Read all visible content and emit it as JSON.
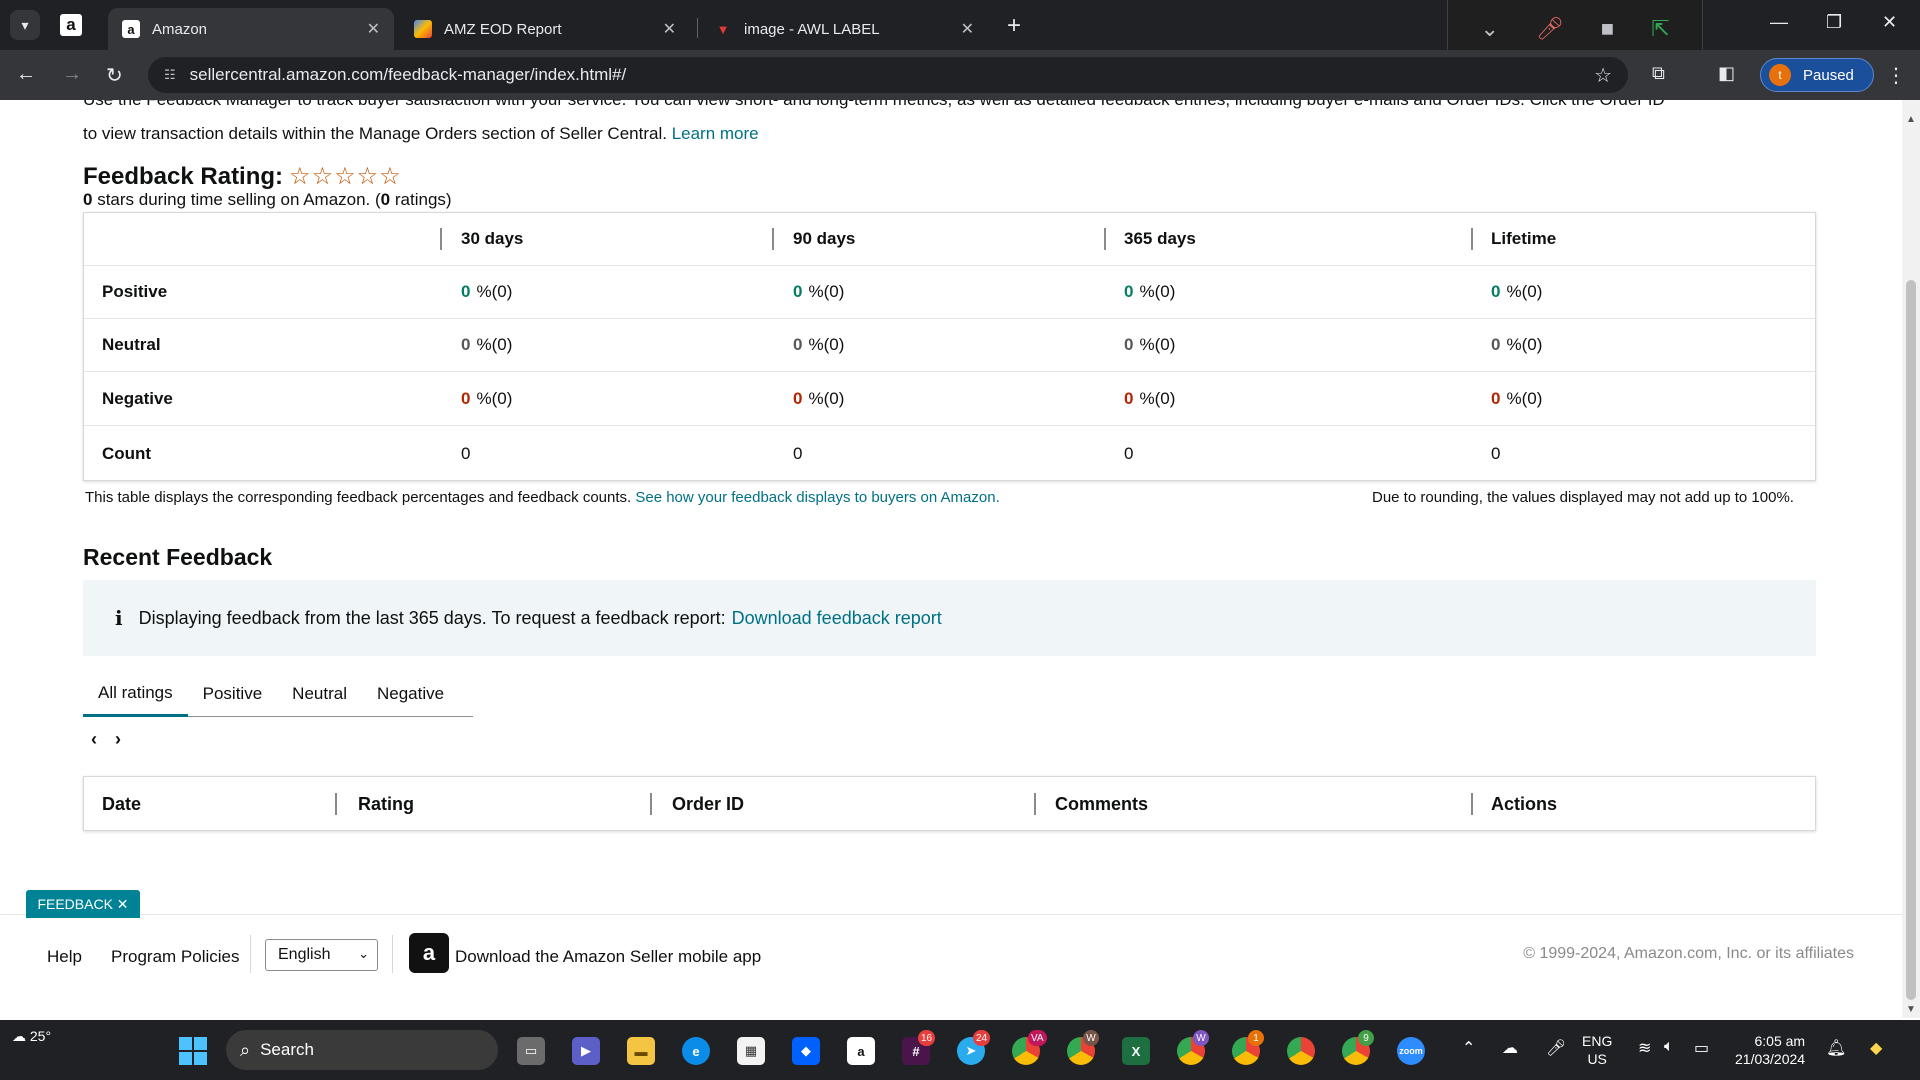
{
  "browser": {
    "tabs": [
      {
        "title": "Amazon",
        "active": true
      },
      {
        "title": "AMZ EOD Report",
        "active": false
      },
      {
        "title": "image - AWL LABEL",
        "active": false
      }
    ],
    "url": "sellercentral.amazon.com/feedback-manager/index.html#/",
    "profile": {
      "initial": "t",
      "label": "Paused"
    }
  },
  "intro": {
    "cut_line": "Use the Feedback Manager to track buyer satisfaction with your service. You can view short- and long-term metrics, as well as detailed feedback entries, including buyer e-mails and Order IDs. Click the Order ID",
    "text": "to view transaction details within the Manage Orders section of Seller Central.",
    "learn_more": "Learn more"
  },
  "rating": {
    "heading": "Feedback Rating:",
    "stars": "☆☆☆☆☆",
    "stars_count": "0",
    "during_text": "stars during time selling on Amazon. (",
    "ratings_count": "0",
    "ratings_suffix": "ratings)"
  },
  "feedback_table": {
    "columns": [
      "30 days",
      "90 days",
      "365 days",
      "Lifetime"
    ],
    "rows": [
      {
        "label": "Positive",
        "cells": [
          [
            "0",
            "%(0)"
          ],
          [
            "0",
            "%(0)"
          ],
          [
            "0",
            "%(0)"
          ],
          [
            "0",
            "%(0)"
          ]
        ]
      },
      {
        "label": "Neutral",
        "cells": [
          [
            "0",
            "%(0)"
          ],
          [
            "0",
            "%(0)"
          ],
          [
            "0",
            "%(0)"
          ],
          [
            "0",
            "%(0)"
          ]
        ]
      },
      {
        "label": "Negative",
        "cells": [
          [
            "0",
            "%(0)"
          ],
          [
            "0",
            "%(0)"
          ],
          [
            "0",
            "%(0)"
          ],
          [
            "0",
            "%(0)"
          ]
        ]
      },
      {
        "label": "Count",
        "cells": [
          "0",
          "0",
          "0",
          "0"
        ]
      }
    ]
  },
  "notes": {
    "left": "This table displays the corresponding feedback percentages and feedback counts.",
    "left_link": "See how your feedback displays to buyers on Amazon.",
    "right": "Due to rounding, the values displayed may not add up to 100%."
  },
  "recent": {
    "title": "Recent Feedback",
    "info_text": "Displaying feedback from the last 365 days. To request a feedback report:",
    "info_link": "Download feedback report",
    "tabs": [
      "All ratings",
      "Positive",
      "Neutral",
      "Negative"
    ],
    "active_tab": "All ratings",
    "columns": [
      "Date",
      "Rating",
      "Order ID",
      "Comments",
      "Actions"
    ]
  },
  "footer": {
    "help": "Help",
    "policies": "Program Policies",
    "language": "English",
    "app_text": "Download the Amazon Seller mobile app",
    "copyright": "© 1999-2024, Amazon.com, Inc. or its affiliates",
    "feedback_button": "FEEDBACK ✕"
  },
  "taskbar": {
    "weather": "25°",
    "search": "Search",
    "badges": {
      "slack": "16",
      "telegram": "24",
      "chrome_va": "VA",
      "chrome_w": "W",
      "chrome_w2": "W",
      "chrome_1": "1",
      "chrome_9": "9"
    },
    "lang_top": "ENG",
    "lang_bottom": "US",
    "time": "6:05 am",
    "date": "21/03/2024"
  },
  "colors": {
    "link": "#007185",
    "positive": "#067d62",
    "negative": "#b12704",
    "accent_tab": "#007185",
    "feedback_button": "#008296"
  }
}
